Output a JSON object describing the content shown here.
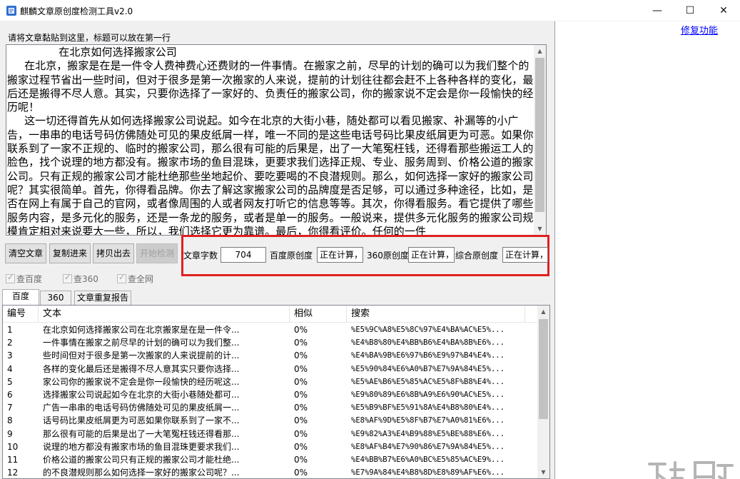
{
  "window": {
    "title": "麒麟文章原创度检测工具v2.0",
    "minimize": "—",
    "maximize": "☐",
    "close": "✕"
  },
  "instruction": "请将文章黏贴到这里，标题可以放在第一行",
  "repair_link": "修复功能",
  "article": {
    "text": "               在北京如何选择搬家公司\n     在北京，搬家是在是一件令人费神费心还费财的一件事情。在搬家之前，尽早的计划的确可以为我们整个的搬家过程节省出一些时间，但对于很多是第一次搬家的人来说，提前的计划往往都会赶不上各种各样的变化，最后还是搬得不尽人意。其实，只要你选择了一家好的、负责任的搬家公司，你的搬家说不定会是你一段愉快的经历呢！\n     这一切还得首先从如何选择搬家公司说起。如今在北京的大街小巷，随处都可以看见搬家、补漏等的小广告，一串串的电话号码仿佛随处可见的果皮纸屑一样，唯一不同的是这些电话号码比果皮纸屑更为可恶。如果你联系到了一家不正规的、临时的搬家公司，那么很有可能的后果是，出了一大笔冤枉钱，还得看那些搬运工人的脸色，找个说理的地方都没有。搬家市场的鱼目混珠，更要求我们选择正规、专业、服务周到、价格公道的搬家公司。只有正规的搬家公司才能杜绝那些坐地起价、要吃要喝的不良潜规则。那么，如何选择一家好的搬家公司呢？其实很简单。首先，你得看品牌。你去了解这家搬家公司的品牌度是否足够，可以通过多种途径，比如，是否在网上有属于自己的官网，或者像周围的人或者网友打听它的信息等等。其次，你得看服务。看它提供了哪些服务内容，是多元化的服务，还是一条龙的服务，或者是单一的服务。一般说来，提供多元化服务的搬家公司规模肯定相对来说要大一些，所以，我们选择它更为靠谱。最后，你得看评价。任何的一件"
  },
  "buttons": {
    "clear": "清空文章",
    "copy_in": "复制进来",
    "copy_out": "拷贝出去",
    "start": "开始检测"
  },
  "stats": {
    "word_count_label": "文章字数",
    "word_count_value": "704",
    "baidu_label": "百度原创度",
    "baidu_value": "正在计算，请",
    "s360_label": "360原创度",
    "s360_value": "正在计算，请",
    "overall_label": "综合原创度",
    "overall_value": "正在计算，请"
  },
  "checkboxes": [
    {
      "label": "查百度",
      "checked": true
    },
    {
      "label": "查360",
      "checked": true
    },
    {
      "label": "查全网",
      "checked": true
    }
  ],
  "tabs": [
    "百度",
    "360",
    "文章重复报告"
  ],
  "table": {
    "columns": [
      "编号",
      "文本",
      "相似",
      "搜索"
    ],
    "rows": [
      [
        "1",
        "在北京如何选择搬家公司在北京搬家是在是一件令...",
        "0%",
        "%E5%9C%A8%E5%8C%97%E4%BA%AC%E5%..."
      ],
      [
        "2",
        "一件事情在搬家之前尽早的计划的确可以为我们整...",
        "0%",
        "%E4%B8%80%E4%BB%B6%E4%BA%8B%E6%..."
      ],
      [
        "3",
        "些时间但对于很多是第一次搬家的人来说提前的计...",
        "0%",
        "%E4%BA%9B%E6%97%B6%E9%97%B4%E4%..."
      ],
      [
        "4",
        "各样的变化最后还是搬得不尽人意其实只要你选择...",
        "0%",
        "%E5%90%84%E6%A0%B7%E7%9A%84%E5%..."
      ],
      [
        "5",
        "家公司你的搬家说不定会是你一段愉快的经历呢这...",
        "0%",
        "%E5%AE%B6%E5%85%AC%E5%8F%B8%E4%..."
      ],
      [
        "6",
        "选择搬家公司说起如今在北京的大街小巷随处都可...",
        "0%",
        "%E9%80%89%E6%8B%A9%E6%90%AC%E5%..."
      ],
      [
        "7",
        "广告一串串的电话号码仿佛随处可见的果皮纸屑一...",
        "0%",
        "%E5%B9%BF%E5%91%8A%E4%B8%80%E4%..."
      ],
      [
        "8",
        "话号码比果皮纸屑更为可恶如果你联系到了一家不...",
        "0%",
        "%E8%AF%9D%E5%8F%B7%E7%A0%81%E6%..."
      ],
      [
        "9",
        "那么很有可能的后果是出了一大笔冤枉钱还得看那...",
        "0%",
        "%E9%82%A3%E4%B9%88%E5%BE%88%E6%..."
      ],
      [
        "10",
        "说理的地方都没有搬家市场的鱼目混珠更要求我们...",
        "0%",
        "%E8%AF%B4%E7%90%86%E7%9A%84%E5%..."
      ],
      [
        "11",
        "价格公道的搬家公司只有正规的搬家公司才能杜绝...",
        "0%",
        "%E4%BB%B7%E6%A0%BC%E5%85%AC%E9%..."
      ],
      [
        "12",
        "的不良潜规则那么如何选择一家好的搬家公司呢？...",
        "0%",
        "%E7%9A%84%E4%B8%8D%E8%89%AF%E6%..."
      ]
    ]
  },
  "watermark": "下载吧",
  "colors": {
    "highlight_border": "#e02020",
    "link": "#0000ff"
  }
}
